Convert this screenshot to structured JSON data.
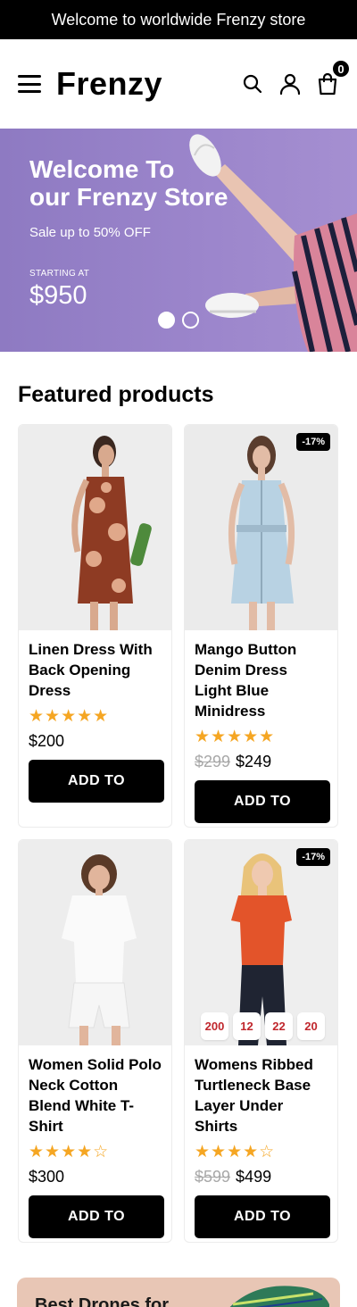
{
  "announcement": "Welcome to worldwide Frenzy store",
  "header": {
    "logo": "Frenzy",
    "cart_count": "0"
  },
  "hero": {
    "title_line1": "Welcome To",
    "title_line2": "our Frenzy Store",
    "subtitle": "Sale up to 50% OFF",
    "starting_label": "STARTING AT",
    "price": "$950",
    "slides": 2,
    "active_slide": 1
  },
  "featured": {
    "title": "Featured products",
    "products": [
      {
        "title": "Linen Dress With Back Opening Dress",
        "rating": 5,
        "stars": "★★★★★",
        "price": "$200",
        "old_price": "",
        "badge": "",
        "button": "ADD TO"
      },
      {
        "title": "Mango Button Denim Dress Light Blue Minidress",
        "rating": 5,
        "stars": "★★★★★",
        "price": "$249",
        "old_price": "$299",
        "badge": "-17%",
        "button": "ADD TO"
      },
      {
        "title": "Women Solid Polo Neck Cotton Blend White T-Shirt",
        "rating": 4,
        "stars": "★★★★☆",
        "price": "$300",
        "old_price": "",
        "badge": "",
        "button": "ADD TO"
      },
      {
        "title": "Womens Ribbed Turtleneck Base Layer Under Shirts",
        "rating": 4,
        "stars": "★★★★☆",
        "price": "$499",
        "old_price": "$599",
        "badge": "-17%",
        "button": "ADD TO",
        "countdown": [
          "200",
          "12",
          "22",
          "20"
        ]
      }
    ]
  },
  "promo": {
    "text": "Best Drones for"
  },
  "colors": {
    "hero_bg": "#9b85cb",
    "star": "#f5a623",
    "countdown_text": "#c0272d",
    "promo_bg": "#e8c6b5"
  }
}
